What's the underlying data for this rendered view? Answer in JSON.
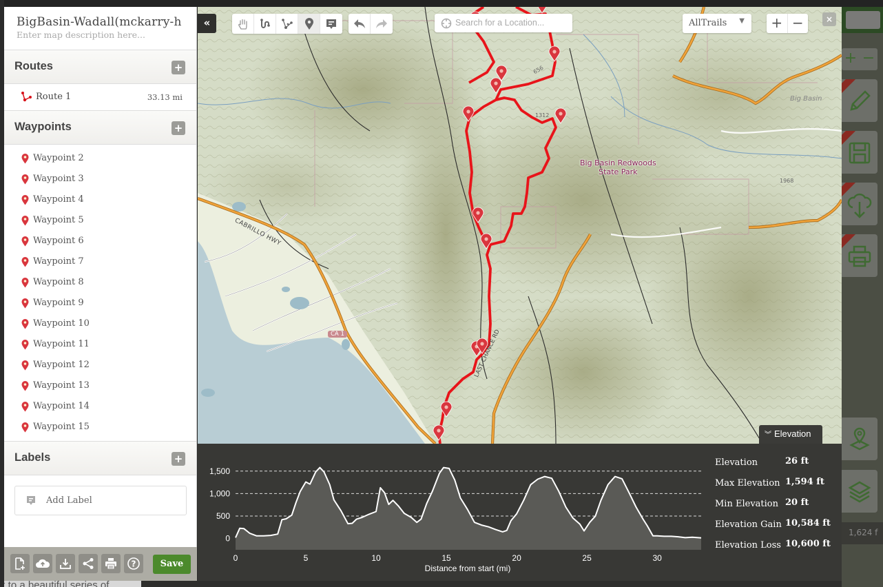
{
  "map_info": {
    "title": "BigBasin-Wadall(mckarry-h",
    "description_placeholder": "Enter map description here..."
  },
  "sections": {
    "routes": {
      "title": "Routes",
      "add_label": "+"
    },
    "waypoints": {
      "title": "Waypoints",
      "add_label": "+"
    },
    "labels": {
      "title": "Labels",
      "add_label": "+"
    }
  },
  "routes": [
    {
      "name": "Route 1",
      "distance": "33.13 mi"
    }
  ],
  "waypoints": [
    {
      "name": "Waypoint 2"
    },
    {
      "name": "Waypoint 3"
    },
    {
      "name": "Waypoint 4"
    },
    {
      "name": "Waypoint 5"
    },
    {
      "name": "Waypoint 6"
    },
    {
      "name": "Waypoint 7"
    },
    {
      "name": "Waypoint 8"
    },
    {
      "name": "Waypoint 9"
    },
    {
      "name": "Waypoint 10"
    },
    {
      "name": "Waypoint 11"
    },
    {
      "name": "Waypoint 12"
    },
    {
      "name": "Waypoint 13"
    },
    {
      "name": "Waypoint 14"
    },
    {
      "name": "Waypoint 15"
    }
  ],
  "labels_panel": {
    "add_label": "Add Label"
  },
  "sidebar_toolbar": {
    "buttons": [
      {
        "icon": "new-file-icon"
      },
      {
        "icon": "upload-cloud-icon"
      },
      {
        "icon": "download-icon"
      },
      {
        "icon": "share-icon"
      },
      {
        "icon": "print-icon"
      },
      {
        "icon": "help-icon"
      }
    ],
    "save_label": "Save"
  },
  "map_toolbar": {
    "collapse_label": "«",
    "tools": [
      {
        "icon": "hand-pan-icon",
        "active": false
      },
      {
        "icon": "draw-route-icon",
        "active": false
      },
      {
        "icon": "route-points-icon",
        "active": false
      },
      {
        "icon": "waypoint-pin-icon",
        "active": true
      },
      {
        "icon": "label-note-icon",
        "active": false
      }
    ],
    "history": [
      {
        "icon": "undo-icon"
      },
      {
        "icon": "redo-icon"
      }
    ],
    "search_placeholder": "Search for a Location...",
    "layer": "AllTrails",
    "zoom_in": "+",
    "zoom_out": "−",
    "close": "×"
  },
  "map_labels": {
    "park": "Big Basin Redwoods",
    "park2": "State Park",
    "highway": "CABRILLO HWY",
    "highway_shield": "CA 1",
    "road": "LAST CHANCE RD",
    "town": "Big Basin",
    "contours": [
      "656",
      "1312",
      "1968"
    ]
  },
  "elevation_tab": {
    "label": "Elevation"
  },
  "elevation_stats": [
    {
      "label": "Elevation",
      "value": "26 ft"
    },
    {
      "label": "Max Elevation",
      "value": "1,594 ft"
    },
    {
      "label": "Min Elevation",
      "value": "20 ft"
    },
    {
      "label": "Elevation Gain",
      "value": "10,584 ft"
    },
    {
      "label": "Elevation Loss",
      "value": "10,600 ft"
    }
  ],
  "background": {
    "right_elev_value": "1,624 f",
    "page_text": "k to a beautiful series of"
  },
  "colors": {
    "route": "#e8141a",
    "accent_green": "#4c8a2c",
    "panel_dark": "#383835"
  },
  "chart_data": {
    "type": "area",
    "title": "",
    "xlabel": "Distance from start (mi)",
    "ylabel": "",
    "xlim": [
      0,
      33.13
    ],
    "ylim": [
      -250,
      1650
    ],
    "xticks": [
      0,
      5,
      10,
      15,
      20,
      25,
      30
    ],
    "yticks": [
      0,
      500,
      1000,
      1500
    ],
    "ytick_labels": [
      "0",
      "500",
      "1,000",
      "1,500"
    ],
    "grid": "horizontal dashed",
    "x": [
      0,
      0.3,
      0.6,
      1.0,
      1.5,
      2.0,
      2.5,
      3.0,
      3.3,
      3.6,
      4.0,
      4.3,
      4.6,
      5.0,
      5.3,
      5.7,
      6.0,
      6.3,
      6.7,
      7.0,
      7.5,
      8.0,
      8.3,
      8.6,
      9.0,
      9.5,
      10.0,
      10.3,
      10.6,
      10.9,
      11.2,
      11.6,
      12.0,
      12.5,
      12.9,
      13.2,
      13.6,
      14.0,
      14.5,
      14.8,
      15.2,
      15.6,
      16.0,
      16.5,
      17.0,
      17.5,
      18.0,
      18.5,
      19.0,
      19.3,
      19.6,
      20.0,
      20.5,
      21.0,
      21.5,
      22.0,
      22.5,
      23.0,
      23.5,
      24.0,
      24.5,
      24.8,
      25.2,
      25.6,
      26.0,
      26.5,
      27.0,
      27.5,
      28.0,
      28.5,
      29.0,
      29.3,
      29.7,
      30.0,
      30.5,
      31.0,
      31.5,
      32.0,
      32.5,
      33.13
    ],
    "y": [
      20,
      230,
      220,
      120,
      60,
      60,
      70,
      100,
      420,
      440,
      520,
      800,
      1050,
      1260,
      1210,
      1480,
      1580,
      1480,
      1200,
      860,
      620,
      330,
      340,
      430,
      470,
      540,
      600,
      1130,
      1020,
      760,
      850,
      720,
      560,
      470,
      360,
      430,
      780,
      1050,
      1450,
      1580,
      1560,
      1300,
      900,
      650,
      360,
      300,
      260,
      200,
      150,
      180,
      400,
      550,
      850,
      1200,
      1320,
      1380,
      1340,
      1050,
      700,
      460,
      320,
      170,
      360,
      500,
      850,
      1200,
      1380,
      1330,
      1020,
      700,
      430,
      280,
      60,
      60,
      50,
      50,
      40,
      20,
      30,
      15
    ]
  }
}
